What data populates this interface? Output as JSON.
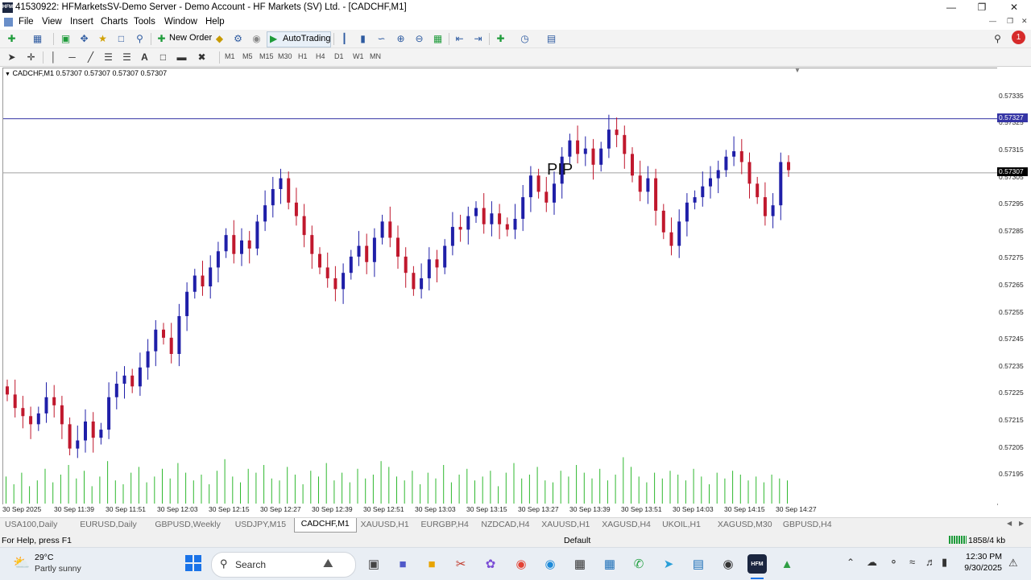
{
  "window": {
    "title": "41530922: HFMarketsSV-Demo Server - Demo Account - HF Markets (SV) Ltd. - [CADCHF,M1]",
    "app_icon_text": "HFM"
  },
  "menu": [
    "File",
    "View",
    "Insert",
    "Charts",
    "Tools",
    "Window",
    "Help"
  ],
  "toolbar": {
    "new_order_label": "New Order",
    "autotrading_label": "AutoTrading",
    "timeframes": [
      "M1",
      "M5",
      "M15",
      "M30",
      "H1",
      "H4",
      "D1",
      "W1",
      "MN"
    ],
    "notification_count": "1"
  },
  "chart": {
    "info_line": "CADCHF,M1  0.57307 0.57307 0.57307 0.57307",
    "overlay_text": "PIP",
    "price_labels": [
      "0.57335",
      "0.57325",
      "0.57315",
      "0.57305",
      "0.57295",
      "0.57285",
      "0.57275",
      "0.57265",
      "0.57255",
      "0.57245",
      "0.57235",
      "0.57225",
      "0.57215",
      "0.57205",
      "0.57195"
    ],
    "hline_label": "0.57327",
    "bid_label": "0.57307",
    "time_labels": [
      "30 Sep 2025",
      "30 Sep 11:39",
      "30 Sep 11:51",
      "30 Sep 12:03",
      "30 Sep 12:15",
      "30 Sep 12:27",
      "30 Sep 12:39",
      "30 Sep 12:51",
      "30 Sep 13:03",
      "30 Sep 13:15",
      "30 Sep 13:27",
      "30 Sep 13:39",
      "30 Sep 13:51",
      "30 Sep 14:03",
      "30 Sep 14:15",
      "30 Sep 14:27"
    ],
    "colors": {
      "bull": "#1f1fa8",
      "bear": "#c0182d",
      "volume": "#2fb82f",
      "hline": "#3535a5",
      "bidline": "#a0a0a0"
    }
  },
  "chart_data": {
    "type": "candlestick",
    "symbol": "CADCHF",
    "timeframe": "M1",
    "ylim": [
      0.5719,
      0.5734
    ],
    "hline": 0.57327,
    "bid": 0.57307,
    "close_series": [
      0.57225,
      0.5722,
      0.57217,
      0.57214,
      0.57218,
      0.57224,
      0.57221,
      0.57214,
      0.57205,
      0.57208,
      0.57215,
      0.57209,
      0.57212,
      0.57224,
      0.57229,
      0.57232,
      0.57228,
      0.57235,
      0.57241,
      0.57249,
      0.57246,
      0.5724,
      0.57254,
      0.57263,
      0.57269,
      0.57265,
      0.57272,
      0.57278,
      0.57284,
      0.57277,
      0.57282,
      0.57279,
      0.57289,
      0.57295,
      0.57301,
      0.57305,
      0.57296,
      0.57291,
      0.57284,
      0.57277,
      0.57272,
      0.57268,
      0.57264,
      0.5727,
      0.57276,
      0.5728,
      0.57274,
      0.57283,
      0.57289,
      0.57283,
      0.57276,
      0.5727,
      0.57264,
      0.57268,
      0.57275,
      0.57272,
      0.5728,
      0.57287,
      0.57286,
      0.57291,
      0.57294,
      0.57288,
      0.57292,
      0.57288,
      0.57286,
      0.5729,
      0.57298,
      0.57306,
      0.573,
      0.57296,
      0.57303,
      0.57313,
      0.57319,
      0.57314,
      0.57316,
      0.5731,
      0.57316,
      0.57323,
      0.57321,
      0.57314,
      0.57306,
      0.573,
      0.57305,
      0.57293,
      0.57285,
      0.5728,
      0.57289,
      0.57296,
      0.57298,
      0.57302,
      0.57305,
      0.57308,
      0.57313,
      0.57315,
      0.57311,
      0.57303,
      0.57298,
      0.57291,
      0.57295,
      0.57311,
      0.57308
    ],
    "volume_series": [
      14,
      10,
      16,
      9,
      12,
      18,
      11,
      15,
      20,
      13,
      17,
      9,
      14,
      22,
      12,
      10,
      16,
      19,
      11,
      14,
      18,
      13,
      21,
      16,
      12,
      15,
      10,
      17,
      23,
      14,
      11,
      18,
      16,
      20,
      13,
      12,
      19,
      15,
      10,
      17,
      14,
      21,
      12,
      16,
      11,
      18,
      13,
      15,
      22,
      19,
      14,
      12,
      17,
      10,
      16,
      13,
      20,
      11,
      15,
      18,
      12,
      14,
      17,
      9,
      16,
      21,
      13,
      15,
      19,
      12,
      11,
      17,
      14,
      20,
      16,
      13,
      18,
      12,
      15,
      24,
      19,
      14,
      11,
      16,
      13,
      17,
      15,
      12,
      18,
      14,
      10,
      16,
      13,
      17,
      15,
      12,
      14,
      11,
      15,
      13,
      12
    ]
  },
  "tabs": [
    "USA100,Daily",
    "EURUSD,Daily",
    "GBPUSD,Weekly",
    "USDJPY,M15",
    "CADCHF,M1",
    "XAUUSD,H1",
    "EURGBP,H4",
    "NZDCAD,H4",
    "XAUUSD,H1",
    "XAGUSD,H4",
    "UKOIL,H1",
    "XAGUSD,M30",
    "GBPUSD,H4"
  ],
  "active_tab_index": 4,
  "status": {
    "help": "For Help, press F1",
    "profile": "Default",
    "traffic": "1858/4 kb"
  },
  "taskbar": {
    "weather_temp": "29°C",
    "weather_desc": "Partly sunny",
    "search_placeholder": "Search",
    "time": "12:30 PM",
    "date": "9/30/2025"
  }
}
